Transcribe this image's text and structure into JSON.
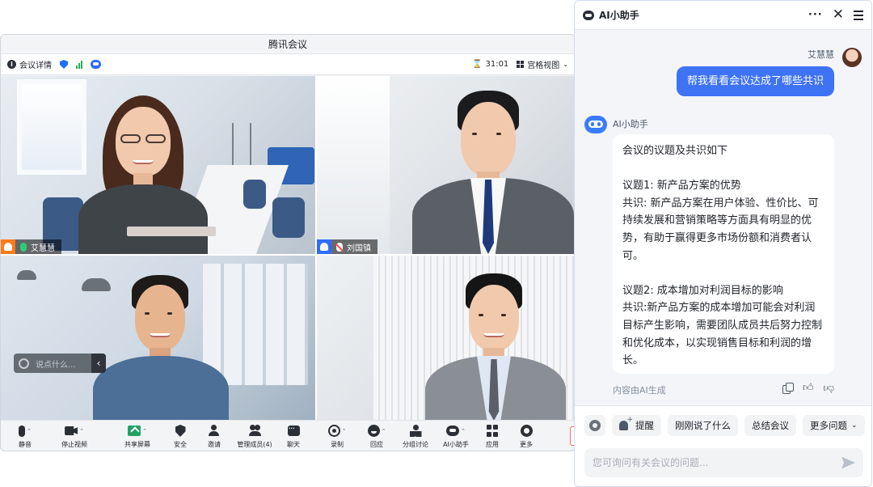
{
  "meeting": {
    "window_title": "腾讯会议",
    "info_label": "会议详情",
    "timer": "31:01",
    "view_label": "宫格视图",
    "chat_placeholder": "说点什么...",
    "participants": [
      {
        "name": "艾慧慧"
      },
      {
        "name": "刘国镇"
      }
    ],
    "toolbar": [
      {
        "label": "静音",
        "icon": "mic-icon"
      },
      {
        "label": "停止视频",
        "icon": "camera-icon"
      },
      {
        "label": "共享屏幕",
        "icon": "share-screen-icon"
      },
      {
        "label": "安全",
        "icon": "shield-icon"
      },
      {
        "label": "邀请",
        "icon": "invite-icon"
      },
      {
        "label": "管理成员(4)",
        "icon": "members-icon"
      },
      {
        "label": "聊天",
        "icon": "chat-icon"
      },
      {
        "label": "录制",
        "icon": "record-icon"
      },
      {
        "label": "回应",
        "icon": "reaction-icon"
      },
      {
        "label": "分组讨论",
        "icon": "breakout-icon"
      },
      {
        "label": "AI小助手",
        "icon": "ai-assistant-icon"
      },
      {
        "label": "应用",
        "icon": "apps-icon"
      },
      {
        "label": "更多",
        "icon": "gear-icon"
      }
    ]
  },
  "assistant": {
    "title": "AI小助手",
    "user_name": "艾慧慧",
    "user_message": "帮我看看会议达成了哪些共识",
    "bot_name": "AI小助手",
    "response": {
      "heading": "会议的议题及共识如下",
      "topic1_title": "议题1: 新产品方案的优势",
      "topic1_body": "共识: 新产品方案在用户体验、性价比、可持续发展和营销策略等方面具有明显的优势，有助于赢得更多市场份额和消费者认可。",
      "topic2_title": "议题2: 成本增加对利润目标的影响",
      "topic2_body": "共识:新产品方案的成本增加可能会对利润目标产生影响，需要团队成员共后努力控制和优化成本，以实现销售目标和利润的增长。"
    },
    "generated_note": "内容由AI生成",
    "quick_actions": {
      "remind": "提醒",
      "just_said": "刚刚说了什么",
      "summary": "总结会议",
      "more": "更多问题"
    },
    "input_placeholder": "您可询问有关会议的问题..."
  },
  "colors": {
    "accent": "#3f73f6",
    "share_green": "#21a366",
    "host_orange": "#ff7a1a"
  }
}
